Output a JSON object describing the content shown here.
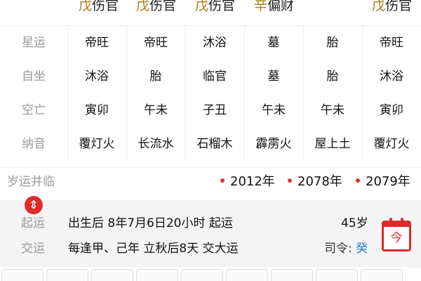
{
  "top_row": [
    {
      "gan": "戊",
      "rest": "伤官"
    },
    {
      "gan": "戊",
      "rest": "伤官"
    },
    {
      "gan": "戊",
      "rest": "伤官"
    },
    {
      "gan": "辛",
      "rest": "偏财"
    },
    {
      "gan": "",
      "rest": ""
    },
    {
      "gan": "戊",
      "rest": "伤官"
    }
  ],
  "grid": {
    "rows": [
      {
        "label": "星运",
        "cells": [
          "帝旺",
          "帝旺",
          "沐浴",
          "墓",
          "胎",
          "帝旺"
        ]
      },
      {
        "label": "自坐",
        "cells": [
          "沐浴",
          "胎",
          "临官",
          "墓",
          "胎",
          "沐浴"
        ]
      },
      {
        "label": "空亡",
        "cells": [
          "寅卯",
          "午未",
          "子丑",
          "午未",
          "午未",
          "寅卯"
        ]
      },
      {
        "label": "纳音",
        "cells": [
          "覆灯火",
          "长流水",
          "石榴木",
          "霹雳火",
          "屋上土",
          "覆灯火"
        ]
      }
    ]
  },
  "year_bar": {
    "title": "岁运并临",
    "years": [
      "2012年",
      "2078年",
      "2079年"
    ]
  },
  "start": {
    "arrow_icon": "up-down-arrow-icon",
    "qiyun_label": "起运",
    "qiyun_text": "出生后 8年7月6日20小时 起运",
    "jiaoyun_label": "交运",
    "jiaoyun_text": "每逢甲、己年 立秋后8天 交大运",
    "age": "45岁",
    "siling_prefix": "司令:",
    "siling_gan": "癸",
    "calendar_icon": "calendar-icon",
    "calendar_char": "今"
  },
  "colors": {
    "accent_red": "#e02b2b",
    "gold": "#b07a10",
    "blue": "#2a7bd8"
  }
}
